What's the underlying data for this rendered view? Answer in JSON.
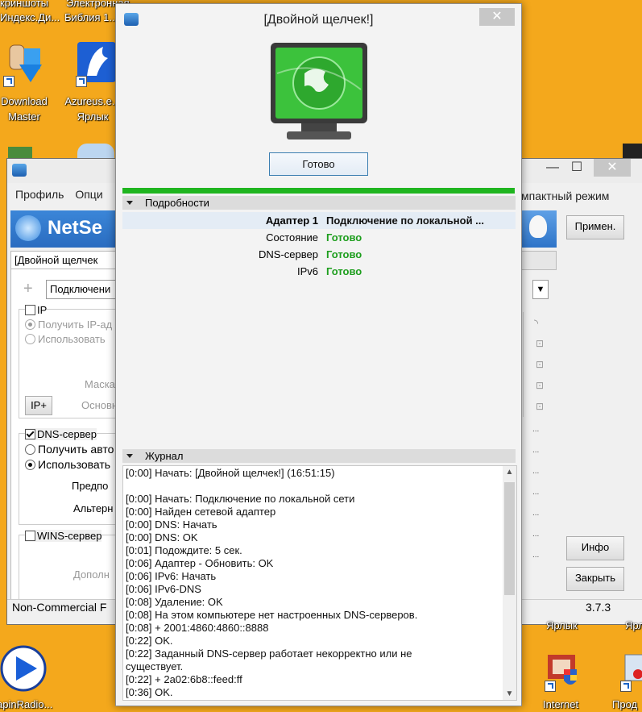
{
  "desktop": {
    "top_labels": [
      "криншоты",
      "Электронная",
      "Индекс.Ди...",
      "Библия 1..."
    ],
    "icons": [
      {
        "name": "download-master",
        "line1": "Download",
        "line2": "Master"
      },
      {
        "name": "azureus",
        "line1": "Azureus.e...",
        "line2": "Ярлык"
      },
      {
        "name": "apinradio",
        "line1": "apinRadio..."
      },
      {
        "name": "internet",
        "line1": "Internet"
      },
      {
        "name": "prod",
        "line1": "Прод"
      },
      {
        "name": "yarlyk-1",
        "line1": "Ярлык"
      },
      {
        "name": "yarlyk-2",
        "line1": "Ярлык"
      }
    ]
  },
  "back_window": {
    "menu": [
      "Профиль",
      "Опци"
    ],
    "compact_mode": "мпактный режим",
    "app_name": "NetSe",
    "profile_tab": "[Двойной щелчек",
    "connection_select": "Подключени",
    "ip_section": {
      "label": "IP",
      "obtain": "Получить IP-ад",
      "use": "Использовать",
      "mask": "Маска",
      "gateway": "Основн",
      "ip_plus": "IP+"
    },
    "dns_section": {
      "label": "DNS-сервер",
      "obtain": "Получить авто",
      "use": "Использовать",
      "preferred": "Предпо",
      "alternate": "Альтерн"
    },
    "wins_section": {
      "label": "WINS-сервер",
      "extra": "Дополн"
    },
    "buttons": {
      "apply": "Примен.",
      "info": "Инфо",
      "close": "Закрыть"
    },
    "status_left": "Non-Commercial F",
    "version": "3.7.3",
    "dots": "..."
  },
  "dialog": {
    "title": "[Двойной щелчек!]",
    "close_glyph": "✕",
    "ready_button": "Готово",
    "progress": 1.0,
    "details_header": "Подробности",
    "details": [
      {
        "key": "Адаптер 1",
        "value": "Подключение по локальной ...",
        "bold": true
      },
      {
        "key": "Состояние",
        "value": "Готово"
      },
      {
        "key": "DNS-сервер",
        "value": "Готово"
      },
      {
        "key": "IPv6",
        "value": "Готово"
      }
    ],
    "journal_header": "Журнал",
    "journal_lines": [
      "[0:00] Начать: [Двойной щелчек!] (16:51:15)",
      "",
      "[0:00] Начать: Подключение по локальной сети",
      "[0:00] Найден сетевой адаптер",
      "[0:00] DNS: Начать",
      "[0:00] DNS: OK",
      "[0:01] Подождите: 5 сек.",
      "[0:06] Адаптер - Обновить: OK",
      "[0:06] IPv6: Начать",
      "[0:06] IPv6-DNS",
      "[0:08] Удаление: OK",
      "[0:08] На этом компьютере нет настроенных DNS-серверов.",
      "[0:08] + 2001:4860:4860::8888",
      "[0:22] OK.",
      "[0:22] Заданный DNS-сервер работает некорректно или не",
      "существует.",
      "[0:22] + 2a02:6b8::feed:ff",
      "[0:36] OK."
    ]
  },
  "colors": {
    "desktop_bg": "#f4a81c",
    "ready_green": "#1e9e1e",
    "progress_green": "#1fb51f",
    "title_blue": "#1a64c8"
  }
}
